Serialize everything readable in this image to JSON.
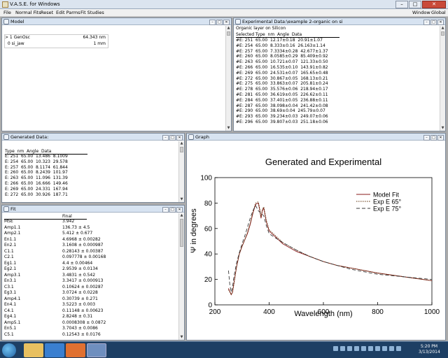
{
  "app": {
    "title": "V.A.S.E. for Windows"
  },
  "menu": {
    "file": "File",
    "normal_fits": "Normal Fits",
    "reset": "Reset",
    "edit_parms": "Edit Parms",
    "fit_studies": "Fit Studies",
    "window": "Window",
    "global": "Global"
  },
  "model": {
    "title": "Model",
    "rows": [
      {
        "prefix": "> 1",
        "name": "GenOsc",
        "value": "64.343 nm"
      },
      {
        "prefix": "  0",
        "name": "si_jaw",
        "value": "1 mm"
      }
    ]
  },
  "exp": {
    "title": "Experimental Data:\\example 2-organic on si",
    "subtitle": "Organic layer on Silicon",
    "header": "Selected Type  nm  Angle  Data",
    "rows": [
      "#E: 251  65.00  12.17±0.18  20.91±1.07",
      "#E: 254  65.00  8.333±0.16  26.163±1.14",
      "#E: 257  65.00  7.3334±0.28  42.677±1.37",
      "#E: 260  65.00  8.0585±0.29  85.409±0.92",
      "#E: 263  65.00  10.721±0.07  121.33±0.50",
      "#E: 266  65.00  16.535±0.10  143.91±0.82",
      "#E: 269  65.00  24.531±0.07  165.65±0.48",
      "#E: 272  65.00  30.867±0.05  168.13±0.21",
      "#E: 275  65.00  33.863±0.07  205.81±0.24",
      "#E: 278  65.00  35.576±0.06  218.94±0.17",
      "#E: 281  65.00  36.619±0.05  226.62±0.11",
      "#E: 284  65.00  37.401±0.05  236.88±0.11",
      "#E: 287  65.00  38.098±0.04  241.42±0.08",
      "#E: 290  65.00  38.69±0.04  245.79±0.07",
      "#E: 293  65.00  39.234±0.03  249.07±0.06",
      "#E: 296  65.00  39.807±0.03  251.18±0.06"
    ]
  },
  "gen": {
    "title": "Generated Data:",
    "header": "Type  nm  Angle  Data",
    "rows": [
      "E: 251  65.00  13.486  8.1009",
      "E: 254  65.00  10.323  29.578",
      "E: 257  65.00  8.1174  61.844",
      "E: 260  65.00  8.2439  101.97",
      "E: 263  65.00  11.096  131.39",
      "E: 266  65.00  16.666  149.46",
      "E: 269  65.00  24.331  167.94",
      "E: 272  65.00  30.926  187.71"
    ]
  },
  "fit": {
    "title": "Fit",
    "col": "Final",
    "rows": [
      [
        "MSE",
        "3.942"
      ],
      [
        "Amp1.1",
        "136.73 ± 4.5"
      ],
      [
        "Amp2.1",
        "5.412 ± 0.677"
      ],
      [
        "En1.1",
        "4.6968 ± 0.00282"
      ],
      [
        "En2.1",
        "3.1608 ± 0.000987"
      ],
      [
        "C1.1",
        "0.28143 ± 0.00387"
      ],
      [
        "C2.1",
        "0.097778 ± 0.00168"
      ],
      [
        "Eg1.1",
        "4.4 ± 0.00464"
      ],
      [
        "Eg2.1",
        "2.9539 ± 0.0134"
      ],
      [
        "Amp3.1",
        "3.4831 ± 0.542"
      ],
      [
        "En3.1",
        "3.3417 ± 0.000913"
      ],
      [
        "C3.1",
        "0.10624 ± 0.00287"
      ],
      [
        "Eg3.1",
        "3.0724 ± 0.0228"
      ],
      [
        "Amp4.1",
        "0.30739 ± 0.271"
      ],
      [
        "En4.1",
        "3.5223 ± 0.003"
      ],
      [
        "C4.1",
        "0.11148 ± 0.00623"
      ],
      [
        "Eg4.1",
        "2.8248 ± 0.31"
      ],
      [
        "Amp5.1",
        "0.0008308 ± 0.0872"
      ],
      [
        "En5.1",
        "3.7043 ± 0.0086"
      ],
      [
        "C5.1",
        "0.12543 ± 0.0176"
      ]
    ]
  },
  "graph": {
    "title": "Graph"
  },
  "chart_data": {
    "type": "line",
    "title": "Generated and Experimental",
    "xlabel": "Wavelength (nm)",
    "ylabel": "Ψ in degrees",
    "xlim": [
      200,
      1000
    ],
    "ylim": [
      0,
      100
    ],
    "xticks": [
      200,
      400,
      600,
      800,
      1000
    ],
    "yticks": [
      0,
      20,
      40,
      60,
      80,
      100
    ],
    "grid": false,
    "legend": "top-right",
    "series": [
      {
        "name": "Model Fit",
        "style": "solid",
        "color": "#8a1a1a",
        "x": [
          250,
          260,
          265,
          270,
          280,
          290,
          300,
          310,
          320,
          330,
          340,
          350,
          360,
          365,
          370,
          375,
          380,
          390,
          400,
          420,
          450,
          500,
          550,
          600,
          650,
          700,
          800,
          900,
          1000
        ],
        "y": [
          13,
          8,
          10,
          17,
          30,
          40,
          46,
          51,
          56,
          63,
          72,
          79,
          80,
          75,
          68,
          74,
          76,
          65,
          58,
          54,
          48,
          42,
          38,
          34,
          31,
          29,
          25,
          22,
          19
        ]
      },
      {
        "name": "Exp E 65°",
        "style": "dotted",
        "color": "#5a2a00",
        "x": [
          250,
          260,
          265,
          270,
          280,
          290,
          300,
          310,
          320,
          330,
          340,
          350,
          360,
          365,
          370,
          375,
          380,
          390,
          400,
          420,
          450,
          500,
          550,
          600,
          650,
          700,
          800,
          900,
          1000
        ],
        "y": [
          12,
          8,
          10,
          16,
          30,
          40,
          46,
          51,
          57,
          64,
          73,
          80,
          81,
          76,
          69,
          75,
          77,
          66,
          59,
          55,
          49,
          43,
          38,
          34,
          31,
          29,
          25,
          22,
          19
        ]
      },
      {
        "name": "Exp E 75°",
        "style": "dashed",
        "color": "#3a3a3a",
        "x": [
          250,
          255,
          260,
          265,
          270,
          280,
          290,
          300,
          310,
          320,
          330,
          340,
          350,
          360,
          370,
          380,
          390,
          400,
          420,
          450,
          500,
          550,
          600,
          650,
          700,
          800,
          900,
          1000
        ],
        "y": [
          27,
          16,
          10,
          14,
          22,
          33,
          41,
          48,
          54,
          61,
          68,
          74,
          78,
          74,
          72,
          70,
          62,
          56,
          53,
          49,
          43,
          38,
          34,
          31,
          28,
          24,
          22,
          20
        ]
      }
    ]
  },
  "taskbar": {
    "time": "5:20 PM",
    "date": "3/13/2014"
  }
}
